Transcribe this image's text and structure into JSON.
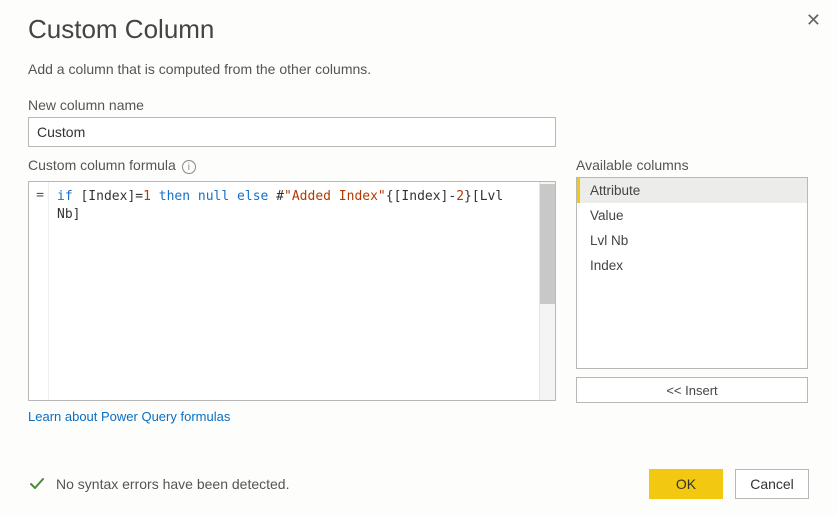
{
  "dialog": {
    "title": "Custom Column",
    "subtitle": "Add a column that is computed from the other columns.",
    "close_label": "Close"
  },
  "name_field": {
    "label": "New column name",
    "value": "Custom"
  },
  "formula": {
    "label": "Custom column formula",
    "gutter_prefix": "=",
    "tokens": {
      "kw_if": "if",
      "t1": " [Index]=",
      "num_1": "1",
      "t2": " ",
      "kw_then": "then",
      "t3": " ",
      "kw_null": "null",
      "t4": " ",
      "kw_else": "else",
      "t5": " #",
      "str_added": "\"Added Index\"",
      "t6": "{[Index]-",
      "num_2": "2",
      "t7": "}[Lvl Nb]"
    },
    "learn_link": "Learn about Power Query formulas"
  },
  "available": {
    "label": "Available columns",
    "items": [
      "Attribute",
      "Value",
      "Lvl Nb",
      "Index"
    ],
    "selected_index": 0,
    "insert_label": "<< Insert"
  },
  "status": {
    "message": "No syntax errors have been detected."
  },
  "buttons": {
    "ok": "OK",
    "cancel": "Cancel"
  }
}
